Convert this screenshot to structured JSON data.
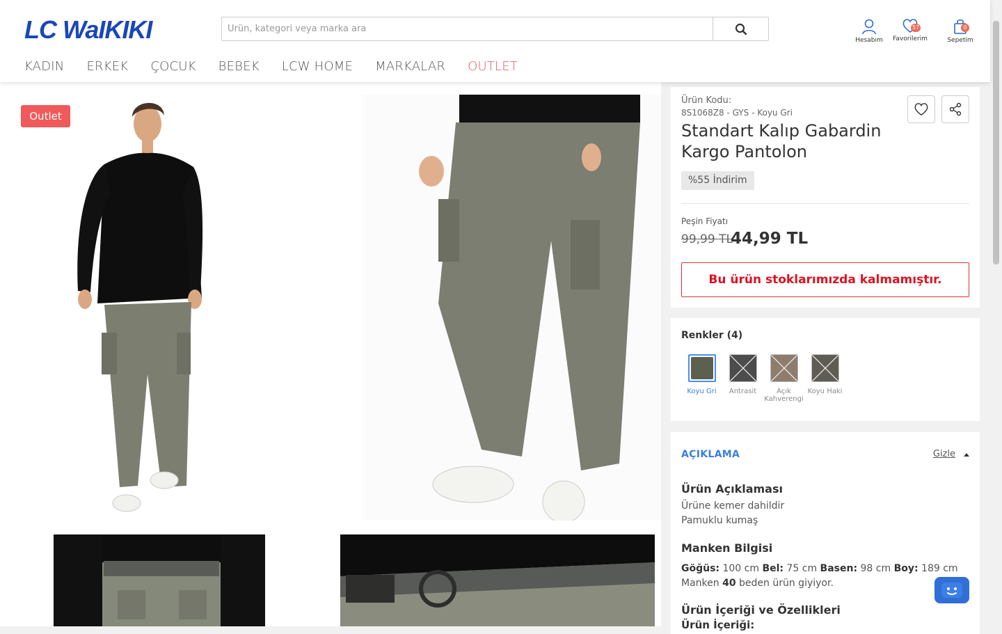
{
  "header": {
    "logo": "LC WaIKIKI",
    "search_placeholder": "Ürün, kategori veya marka ara",
    "account_label": "Hesabım",
    "favorites_label": "Favorilerim",
    "favorites_count": "57",
    "cart_label": "Sepetim",
    "cart_count": "0"
  },
  "nav": {
    "items": [
      "KADIN",
      "ERKEK",
      "ÇOCUK",
      "BEBEK",
      "LCW HOME",
      "MARKALAR",
      "OUTLET"
    ]
  },
  "gallery": {
    "badge": "Outlet"
  },
  "product": {
    "code_label": "Ürün Kodu:",
    "code_value": "8S1068Z8 - GYS - Koyu Gri",
    "title": "Standart Kalıp Gabardin Kargo Pantolon",
    "discount": "%55 İndirim",
    "price_label": "Peşin Fiyatı",
    "old_price": "99,99 TL",
    "new_price": "44,99 TL",
    "stock_message": "Bu ürün stoklarımızda kalmamıştır."
  },
  "colors": {
    "title": "Renkler (4)",
    "items": [
      {
        "name": "Koyu Gri",
        "color": "#5d5f4f",
        "active": true
      },
      {
        "name": "Antrasit",
        "color": "#4c4c4c",
        "active": false
      },
      {
        "name": "Açık Kahverengi",
        "color": "#8d7d6d",
        "active": false
      },
      {
        "name": "Koyu Haki",
        "color": "#5f5c55",
        "active": false
      }
    ]
  },
  "description": {
    "title": "AÇIKLAMA",
    "hide_label": "Gizle",
    "section1_title": "Ürün Açıklaması",
    "section1_line1": "Ürüne kemer dahildir",
    "section1_line2": "Pamuklu kumaş",
    "section2_title": "Manken Bilgisi",
    "chest_label": "Göğüs:",
    "chest_value": "100 cm",
    "waist_label": "Bel:",
    "waist_value": "75 cm",
    "hip_label": "Basen:",
    "hip_value": "98 cm",
    "height_label": "Boy:",
    "height_value": "189 cm",
    "model_prefix": "Manken",
    "model_size": "40",
    "model_suffix": "beden ürün giyiyor.",
    "section3_title": "Ürün İçeriği ve Özellikleri",
    "section3_sub": "Ürün İçeriği:"
  },
  "colors_theme": {
    "brand": "#1a47b8",
    "outlet": "#e45454",
    "accent": "#3a7fe0"
  }
}
